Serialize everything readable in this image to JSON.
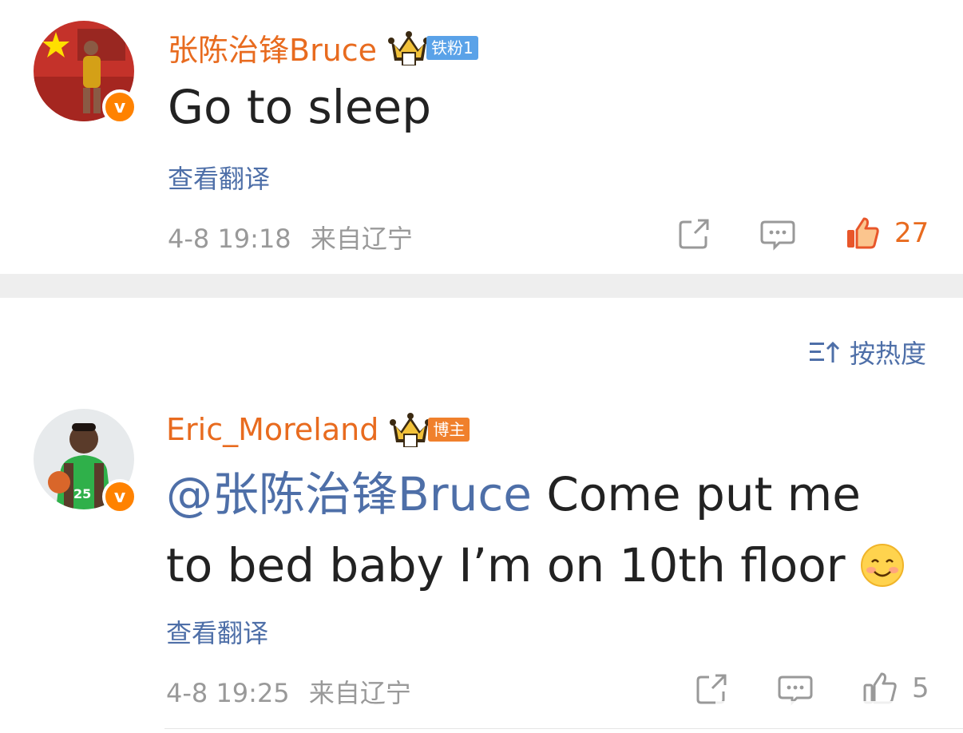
{
  "comments": [
    {
      "username": "张陈治锋Bruce",
      "badge": "铁粉1",
      "text": "Go to sleep",
      "translate": "查看翻译",
      "time": "4-8 19:18",
      "location": "来自辽宁",
      "likes": "27",
      "liked": true
    },
    {
      "username": "Eric_Moreland",
      "badge": "博主",
      "mention": "@张陈治锋Bruce",
      "text_line1": " Come put me",
      "text_line2": "to bed baby I’m on 10th floor",
      "translate": "查看翻译",
      "time": "4-8 19:25",
      "location": "来自辽宁",
      "likes": "5",
      "liked": false
    }
  ],
  "sort": {
    "label": "按热度"
  },
  "colors": {
    "accent": "#e86b1f",
    "link": "#4e6fa8",
    "verified": "#ff8200"
  }
}
